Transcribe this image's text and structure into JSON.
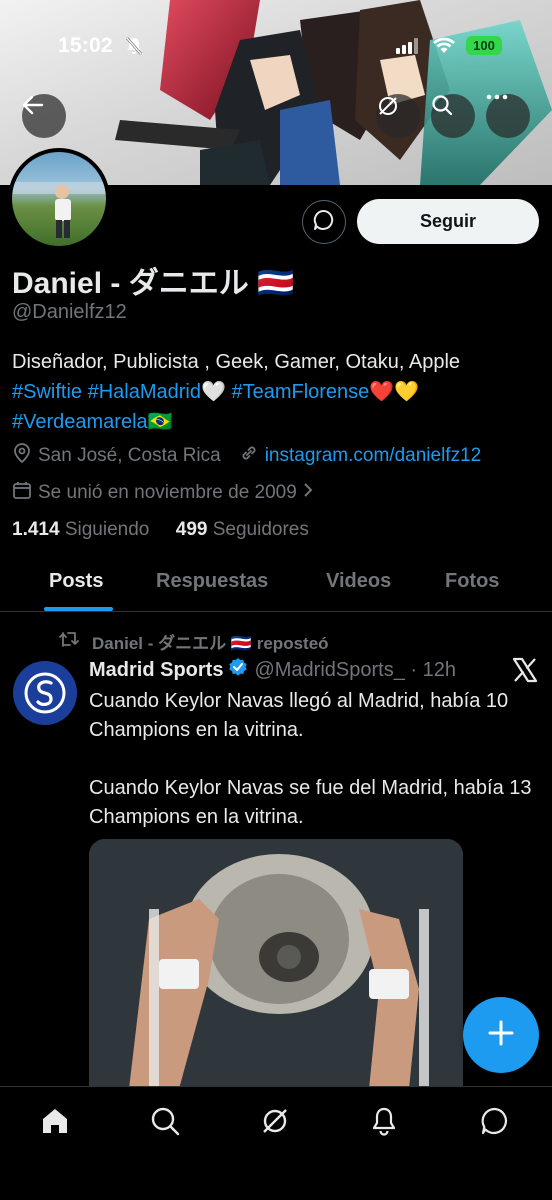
{
  "status_bar": {
    "time": "15:02",
    "battery": "100"
  },
  "profile": {
    "name": "Daniel - ダニエル 🇨🇷",
    "handle": "@Danielfz12",
    "bio_line1": "Diseñador, Publicista , Geek, Gamer, Otaku, Apple",
    "bio_tags_line2": [
      "#Swiftie",
      "#HalaMadrid",
      "🤍",
      "#TeamFlorense",
      "❤️💛"
    ],
    "bio_tag_line3": "#Verdeamarela🇧🇷",
    "location": "San José, Costa Rica",
    "website": "instagram.com/danielfz12",
    "joined": "Se unió en noviembre de 2009",
    "following_count": "1.414",
    "following_label": "Siguiendo",
    "followers_count": "499",
    "followers_label": "Seguidores",
    "follow_button": "Seguir"
  },
  "tabs": [
    "Posts",
    "Respuestas",
    "Videos",
    "Fotos"
  ],
  "post": {
    "repost_label": "Daniel - ダニエル 🇨🇷 reposteó",
    "author_name": "Madrid Sports",
    "author_handle": "@MadridSports_ · 12h",
    "text": "Cuando Keylor Navas llegó al Madrid, había 10 Champions en la vitrina.\n\nCuando Keylor Navas se fue del Madrid, había 13 Champions en la vitrina."
  },
  "colors": {
    "accent": "#1d9bf0",
    "background": "#000000",
    "muted": "#71767b",
    "text": "#e7e9ea"
  },
  "icons": [
    "back-arrow-icon",
    "grok-icon",
    "search-icon",
    "more-icon",
    "message-icon",
    "location-icon",
    "link-icon",
    "calendar-icon",
    "repost-icon",
    "verified-icon",
    "x-logo-icon",
    "compose-icon",
    "home-icon",
    "notifications-icon",
    "messages-icon"
  ]
}
